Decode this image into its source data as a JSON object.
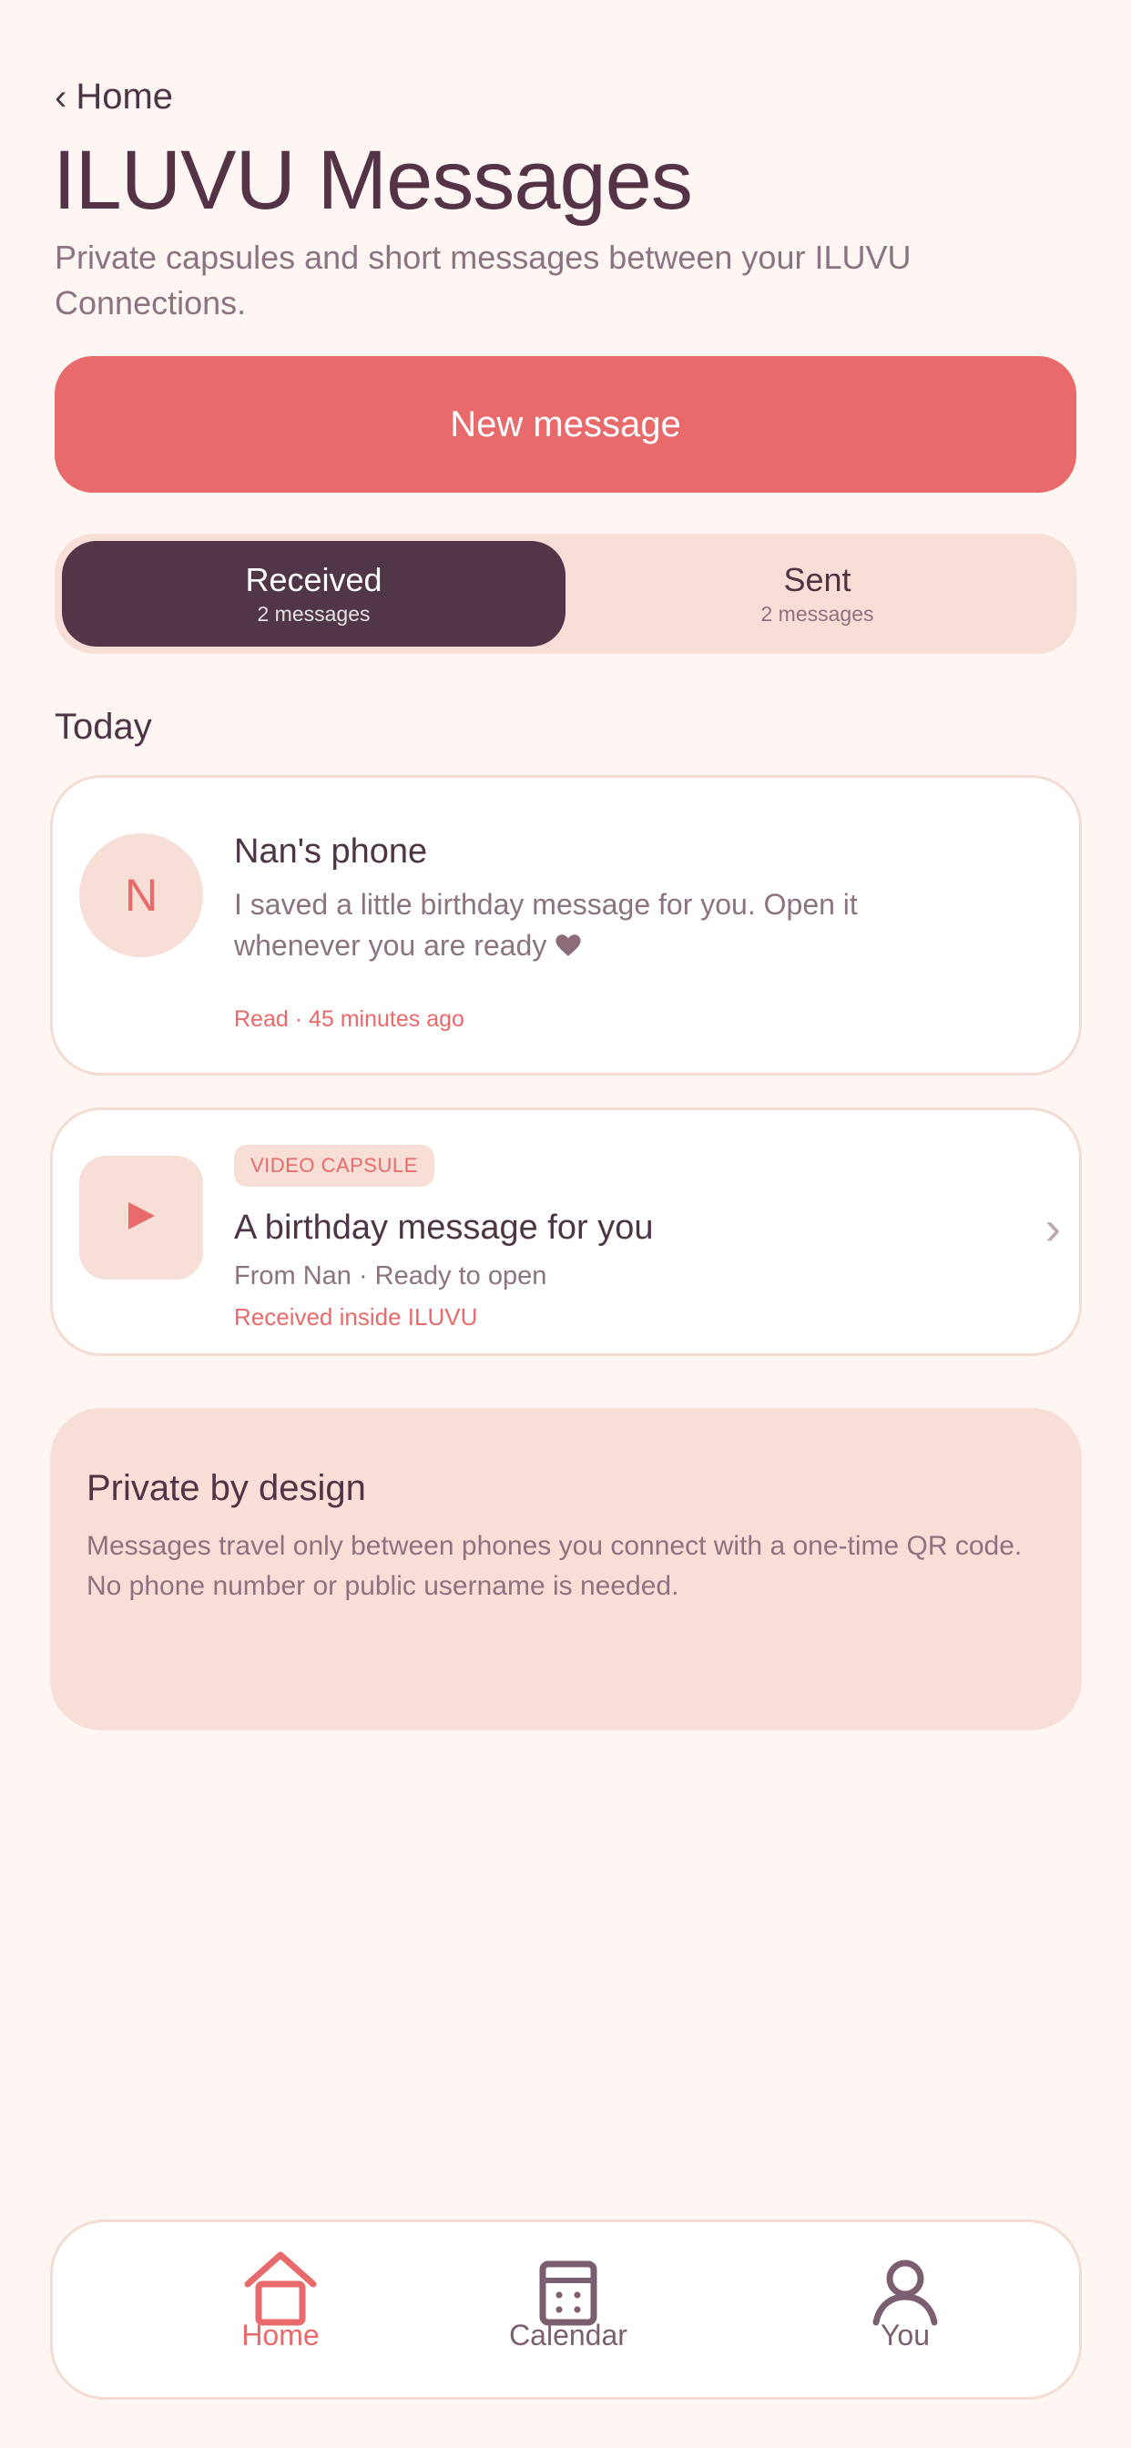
{
  "nav": {
    "back_label": "Home"
  },
  "header": {
    "title": "ILUVU Messages",
    "subtitle": "Private capsules and short messages between your ILUVU Connections."
  },
  "actions": {
    "new_message": "New message"
  },
  "segments": [
    {
      "label": "Received",
      "count": "2 messages",
      "active": true
    },
    {
      "label": "Sent",
      "count": "2 messages",
      "active": false
    }
  ],
  "section_title": "Today",
  "messages": [
    {
      "avatar_letter": "N",
      "sender": "Nan's phone",
      "text": "I saved a little birthday message for you. Open it whenever you are ready",
      "emoji_icon": "heart-icon",
      "meta": "Read · 45 minutes ago"
    }
  ],
  "capsule": {
    "badge": "VIDEO CAPSULE",
    "title": "A birthday message for you",
    "from": "From Nan · Ready to open",
    "received": "Received inside ILUVU",
    "icon": "play-icon"
  },
  "privacy": {
    "heading": "Private by design",
    "body": "Messages travel only between phones you connect with a one-time QR code. No phone number or public username is needed."
  },
  "tabbar": [
    {
      "label": "Home",
      "icon": "home-icon",
      "active": true
    },
    {
      "label": "Calendar",
      "icon": "calendar-icon",
      "active": false
    },
    {
      "label": "You",
      "icon": "user-icon",
      "active": false
    }
  ],
  "colors": {
    "background": "#fdf6f2",
    "accent": "#e86a6a",
    "dark": "#513647",
    "soft": "#f7ded6",
    "muted_text": "#8c7381"
  }
}
